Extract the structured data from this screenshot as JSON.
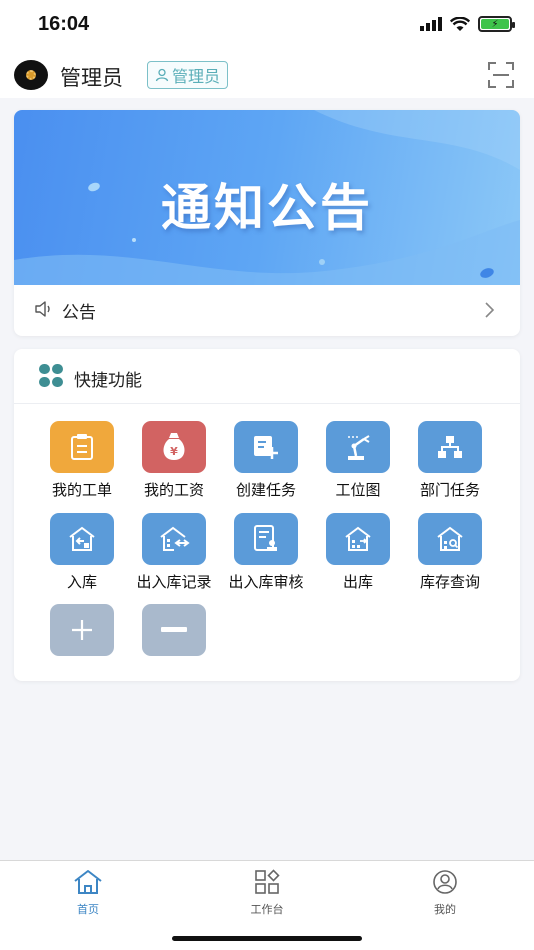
{
  "status_bar": {
    "time": "16:04"
  },
  "header": {
    "user_name": "管理员",
    "role_badge": "管理员"
  },
  "notice": {
    "banner_title": "通知公告",
    "row_label": "公告"
  },
  "quick": {
    "title": "快捷功能",
    "items": [
      {
        "label": "我的工单",
        "icon": "clipboard-icon",
        "color": "#f0a83c"
      },
      {
        "label": "我的工资",
        "icon": "money-bag-icon",
        "color": "#d26362"
      },
      {
        "label": "创建任务",
        "icon": "create-task-icon",
        "color": "#5b9bd9"
      },
      {
        "label": "工位图",
        "icon": "robot-arm-icon",
        "color": "#5b9bd9"
      },
      {
        "label": "部门任务",
        "icon": "org-chart-icon",
        "color": "#5b9bd9"
      },
      {
        "label": "入库",
        "icon": "warehouse-in-icon",
        "color": "#5b9bd9"
      },
      {
        "label": "出入库记录",
        "icon": "warehouse-record-icon",
        "color": "#5b9bd9"
      },
      {
        "label": "出入库审核",
        "icon": "audit-icon",
        "color": "#5b9bd9"
      },
      {
        "label": "出库",
        "icon": "warehouse-out-icon",
        "color": "#5b9bd9"
      },
      {
        "label": "库存查询",
        "icon": "warehouse-search-icon",
        "color": "#5b9bd9"
      }
    ],
    "add_button_icon": "plus-icon",
    "remove_button_icon": "minus-icon",
    "control_color": "#a9b9cc"
  },
  "tabbar": {
    "tabs": [
      {
        "label": "首页",
        "icon": "home-icon",
        "active": true
      },
      {
        "label": "工作台",
        "icon": "workbench-icon",
        "active": false
      },
      {
        "label": "我的",
        "icon": "profile-icon",
        "active": false
      }
    ],
    "active_color": "#3d86c4"
  }
}
